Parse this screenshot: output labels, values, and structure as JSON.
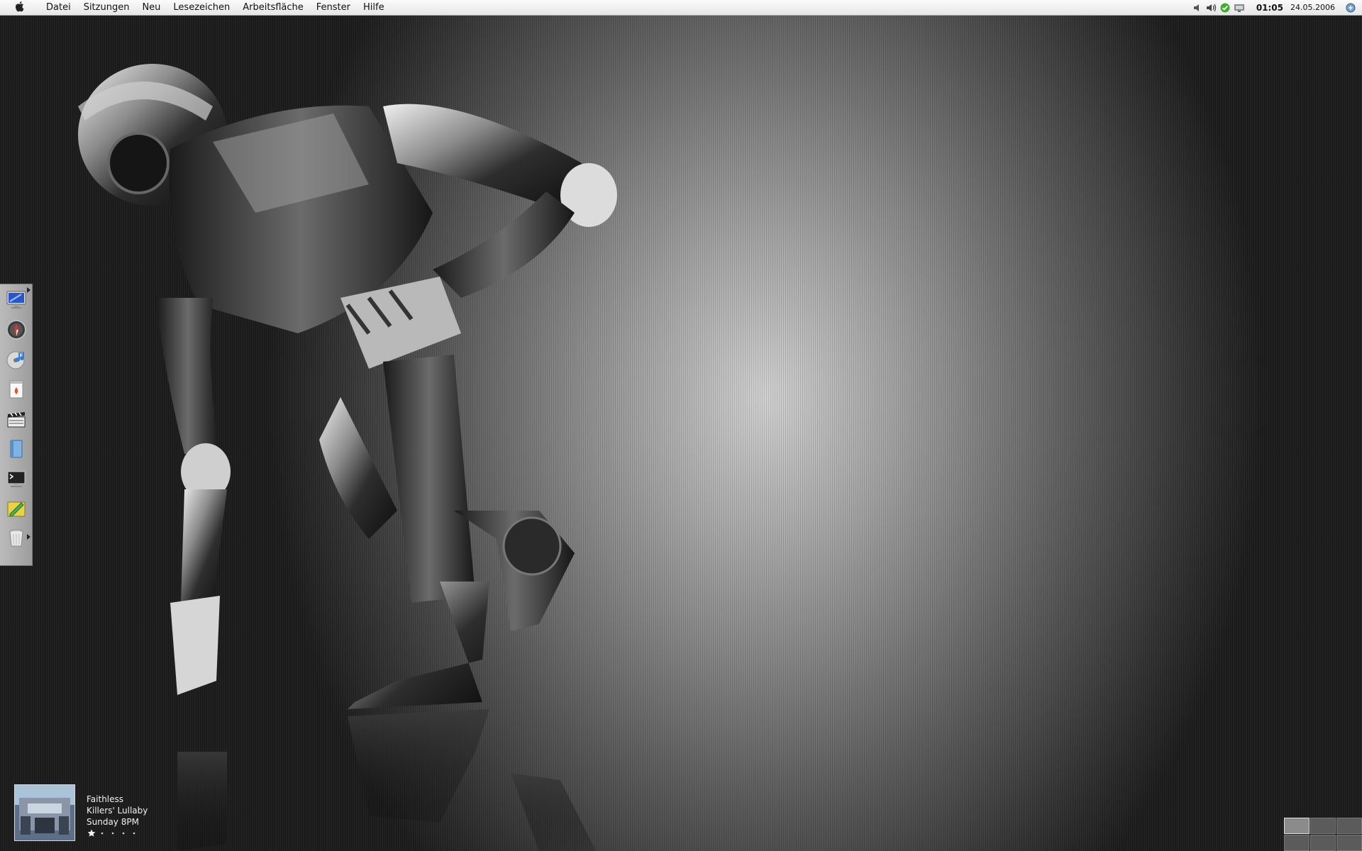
{
  "menubar": {
    "apple_icon": "apple-icon",
    "menus": [
      "Datei",
      "Sitzungen",
      "Neu",
      "Lesezeichen",
      "Arbeitsfläche",
      "Fenster",
      "Hilfe"
    ],
    "tray": {
      "icons": [
        "volume-icon",
        "speaker-icon",
        "check-icon",
        "network-icon",
        "switcher-icon"
      ],
      "time": "01:05",
      "date": "24.05.2006"
    }
  },
  "dock": {
    "items": [
      "monitor-icon",
      "compass-icon",
      "music-cd-icon",
      "document-icon",
      "film-clapper-icon",
      "book-icon",
      "terminal-icon",
      "edit-icon",
      "trash-icon"
    ]
  },
  "now_playing": {
    "artist": "Faithless",
    "title": "Killers' Lullaby",
    "show": "Sunday 8PM",
    "rating": 1,
    "rating_max": 5
  },
  "pager": {
    "desktops": 6,
    "active": 1
  },
  "colors": {
    "menubar_bg": "#efefef",
    "dock_bg": "#bdbdbd",
    "text_light": "#f2f2f2"
  }
}
